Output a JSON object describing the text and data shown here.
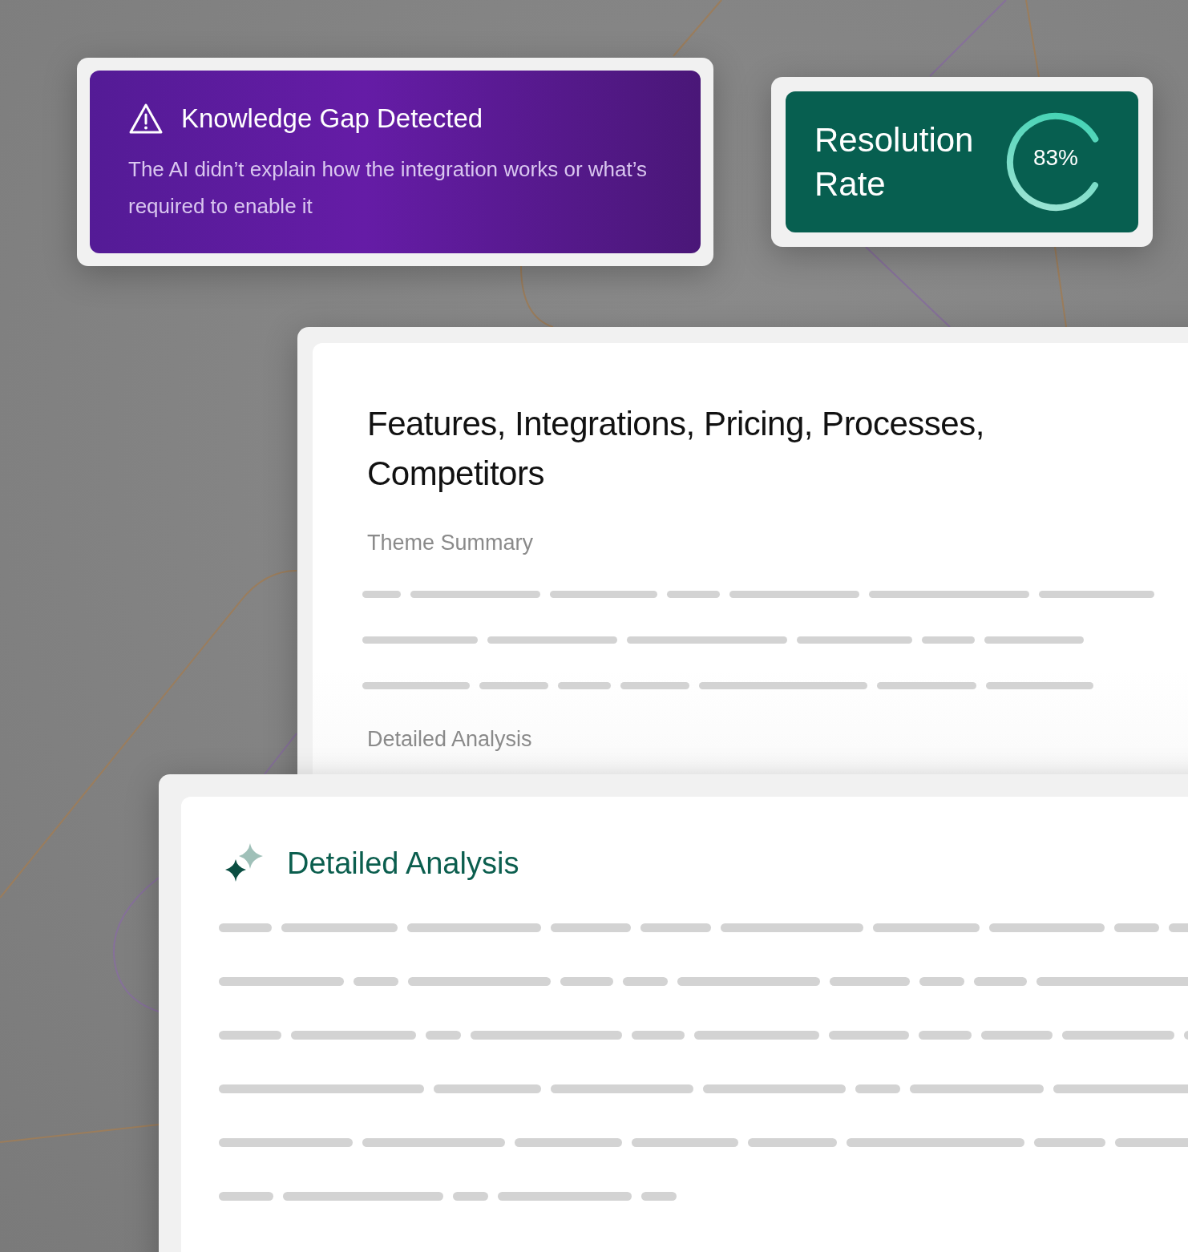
{
  "alert_card": {
    "title": "Knowledge Gap Detected",
    "message": "The AI didn’t explain how the integration works or what’s required to enable it"
  },
  "resolution_card": {
    "title": "Resolution Rate",
    "level": 0.83,
    "reading": "83%"
  },
  "theme_card": {
    "title": "Features, Integrations, Pricing, Processes, Competitors",
    "sections": [
      "Theme Summary",
      "Detailed Analysis"
    ]
  },
  "analysis_card": {
    "title": "Detailed Analysis"
  }
}
